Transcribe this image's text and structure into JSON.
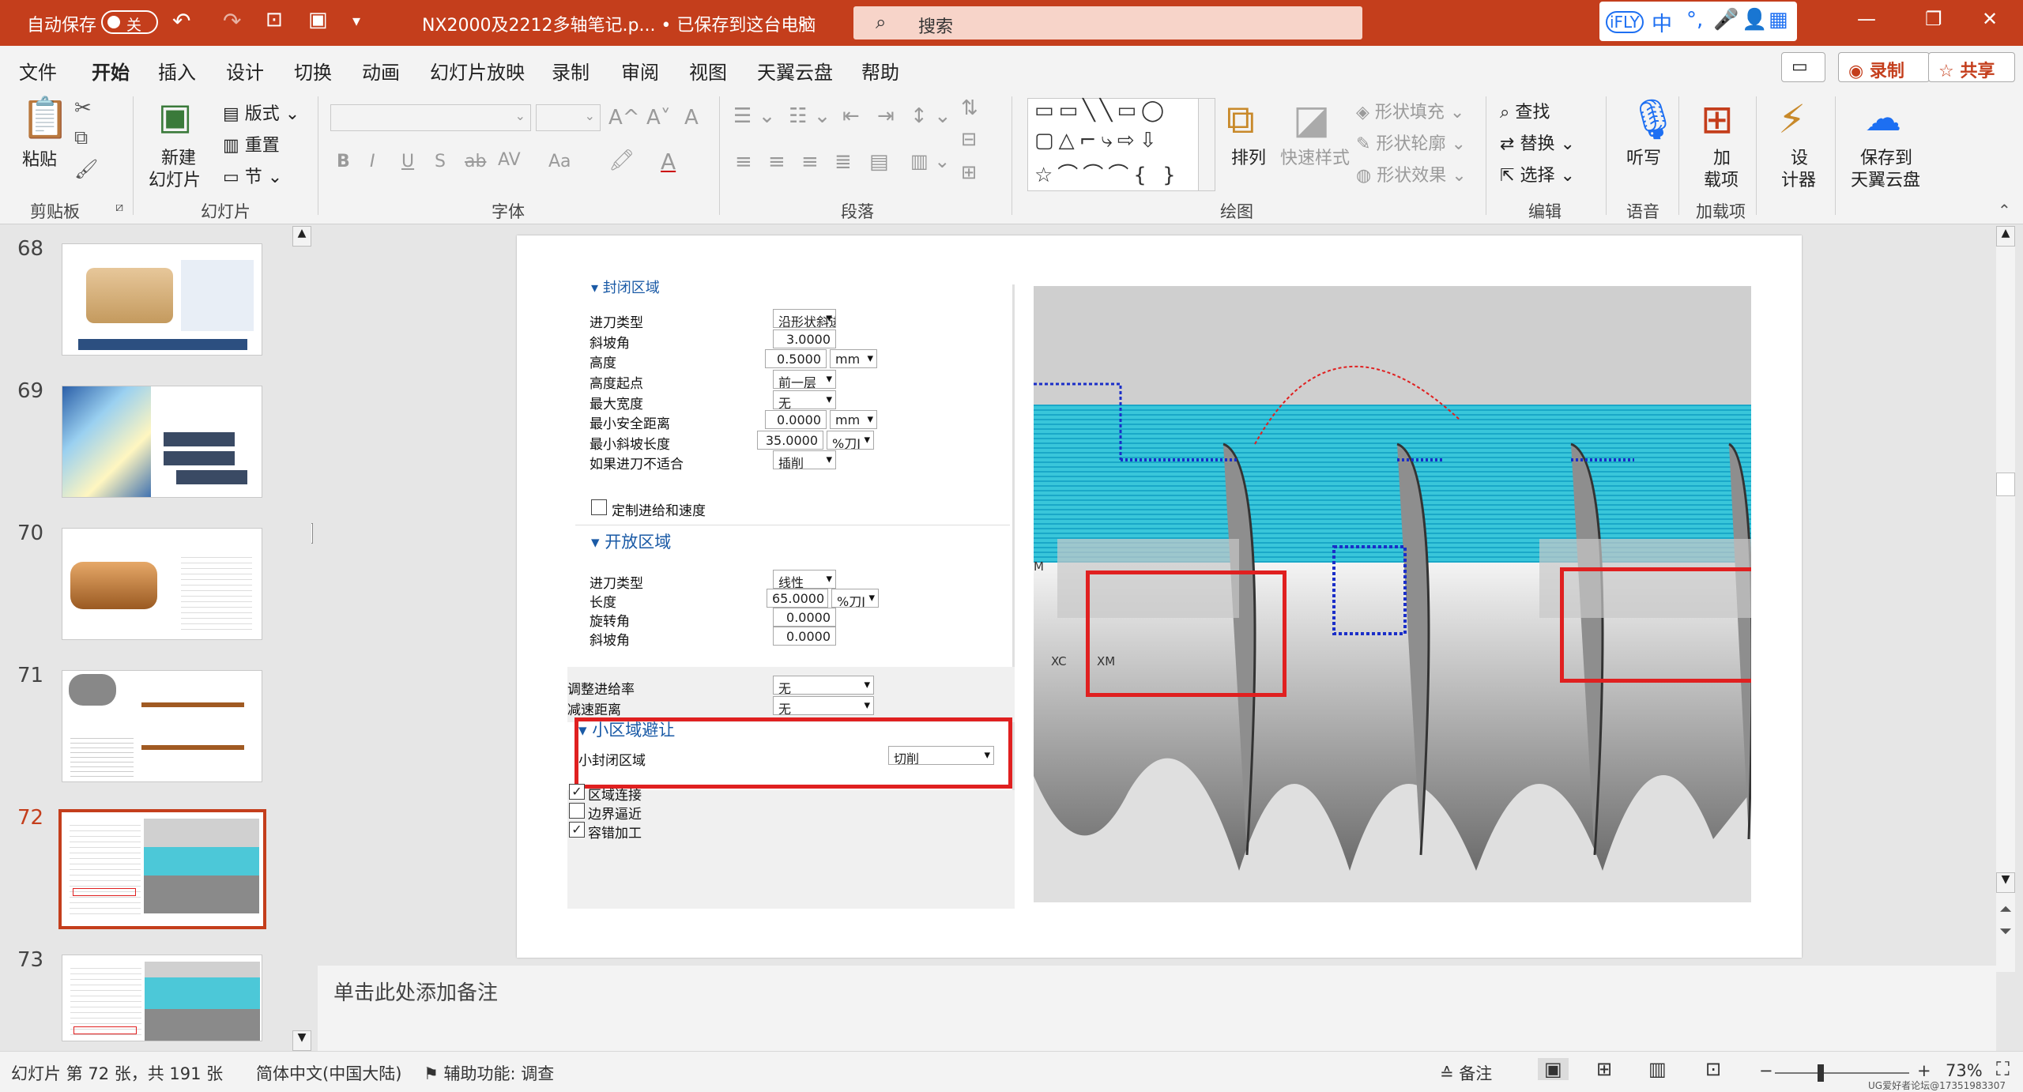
{
  "titlebar": {
    "autosave_label": "自动保存",
    "autosave_state": "关",
    "doc_title": "NX2000及2212多轴笔记.p... • 已保存到这台电脑",
    "search_placeholder": "搜索",
    "ifly": [
      "中",
      "°,",
      "🎤",
      "👤",
      "▦"
    ]
  },
  "tabs": [
    "文件",
    "开始",
    "插入",
    "设计",
    "切换",
    "动画",
    "幻灯片放映",
    "录制",
    "审阅",
    "视图",
    "天翼云盘",
    "帮助"
  ],
  "header_buttons": {
    "comment": "▭",
    "record": "◉ 录制",
    "share": "☆ 共享"
  },
  "ribbon": {
    "clipboard": {
      "paste": "粘贴",
      "group": "剪贴板"
    },
    "slides": {
      "new_slide": "新建",
      "new_slide2": "幻灯片",
      "layout": "版式",
      "reset": "重置",
      "section": "节",
      "group": "幻灯片"
    },
    "font": {
      "bold": "B",
      "italic": "I",
      "underline": "U",
      "shadow": "S",
      "strike": "ab",
      "spacing": "AV",
      "case": "Aa",
      "grow": "A^",
      "shrink": "A˅",
      "clear": "A",
      "group": "字体"
    },
    "paragraph": {
      "group": "段落"
    },
    "drawing": {
      "arrange": "排列",
      "quick_styles": "快速样式",
      "fill": "形状填充",
      "outline": "形状轮廓",
      "effect": "形状效果",
      "group": "绘图"
    },
    "editing": {
      "find": "查找",
      "replace": "替换",
      "select": "选择",
      "group": "编辑"
    },
    "voice": {
      "dictate": "听写",
      "group": "语音"
    },
    "addins": {
      "addins": "加",
      "addins2": "载项",
      "group": "加载项"
    },
    "designer": {
      "d1": "设",
      "d2": "计器"
    },
    "cloud": {
      "c1": "保存到",
      "c2": "天翼云盘"
    }
  },
  "slides_panel": {
    "numbers": [
      "68",
      "69",
      "70",
      "71",
      "72",
      "73"
    ],
    "selected": "72"
  },
  "dialog": {
    "closed_section": "封闭区域",
    "closed_rows": [
      {
        "label": "进刀类型",
        "value": "沿形状斜进刀"
      },
      {
        "label": "斜坡角",
        "value": "3.0000"
      },
      {
        "label": "高度",
        "value": "0.5000",
        "unit": "mm"
      },
      {
        "label": "高度起点",
        "value": "前一层"
      },
      {
        "label": "最大宽度",
        "value": "无"
      },
      {
        "label": "最小安全距离",
        "value": "0.0000",
        "unit": "mm"
      },
      {
        "label": "最小斜坡长度",
        "value": "35.0000",
        "unit": "%刀J"
      },
      {
        "label": "如果进刀不适合",
        "value": "插削"
      }
    ],
    "custom_feed": "定制进给和速度",
    "open_section": "开放区域",
    "open_rows": [
      {
        "label": "进刀类型",
        "value": "线性"
      },
      {
        "label": "长度",
        "value": "65.0000",
        "unit": "%刀J"
      },
      {
        "label": "旋转角",
        "value": "0.0000"
      },
      {
        "label": "斜坡角",
        "value": "0.0000"
      }
    ],
    "feed_rows": [
      {
        "label": "调整进给率",
        "value": "无"
      },
      {
        "label": "减速距离",
        "value": "无"
      }
    ],
    "small_section": "小区域避让",
    "small_row": {
      "label": "小封闭区域",
      "value": "切削"
    },
    "checks": [
      {
        "label": "区域连接",
        "checked": true
      },
      {
        "label": "边界逼近",
        "checked": false
      },
      {
        "label": "容错加工",
        "checked": true
      }
    ]
  },
  "render_labels": {
    "xc": "XC",
    "xm": "XM",
    "m": "M"
  },
  "notes_placeholder": "单击此处添加备注",
  "status": {
    "slide_info": "幻灯片 第 72 张，共 191 张",
    "language": "简体中文(中国大陆)",
    "accessibility": "辅助功能: 调查",
    "notes": "备注",
    "zoom": "73%",
    "watermark": "UG爱好者论坛@17351983307"
  }
}
